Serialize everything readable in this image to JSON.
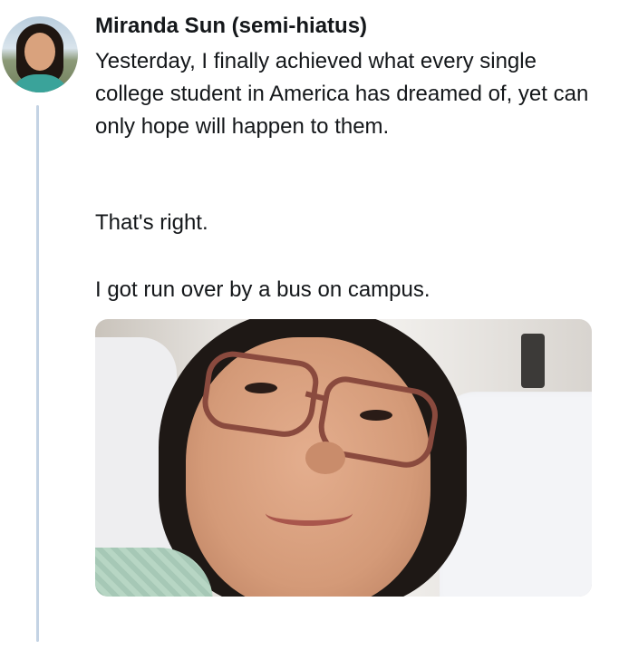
{
  "tweet": {
    "author_name": "Miranda Sun (semi-hiatus)",
    "paragraphs": [
      "Yesterday, I finally achieved what every single college student in America has dreamed of, yet can only hope will happen to them.",
      "That's right.",
      "I got run over by a bus on campus."
    ],
    "colors": {
      "text": "#14171a",
      "thread_line": "#c4d3e4",
      "background": "#ffffff"
    }
  }
}
